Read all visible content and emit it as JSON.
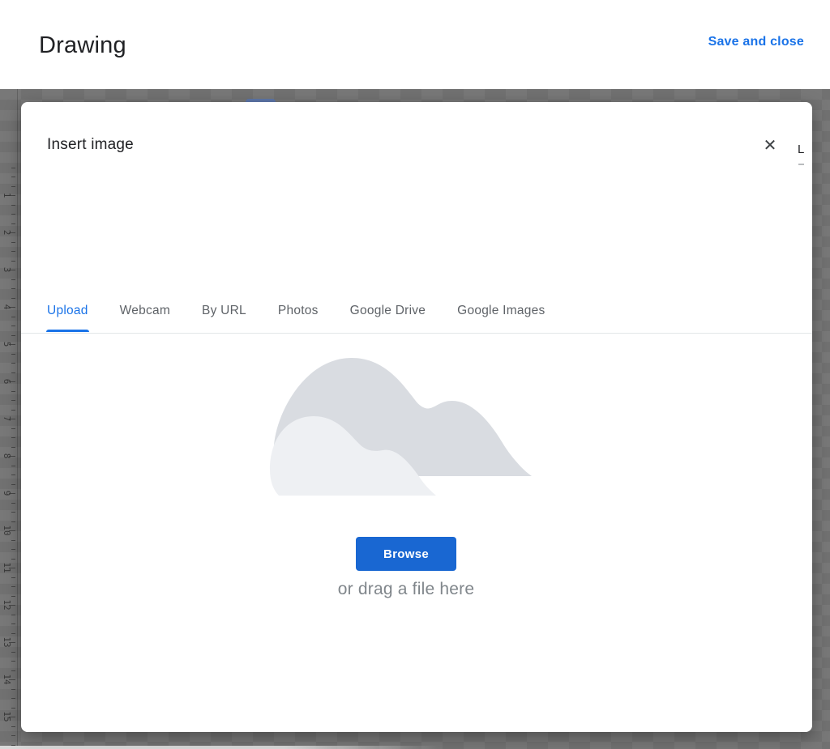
{
  "header": {
    "title": "Drawing",
    "save_and_close": "Save and close"
  },
  "dialog": {
    "title": "Insert image",
    "close_icon": "✕",
    "tabs": [
      {
        "label": "Upload",
        "active": true
      },
      {
        "label": "Webcam",
        "active": false
      },
      {
        "label": "By URL",
        "active": false
      },
      {
        "label": "Photos",
        "active": false
      },
      {
        "label": "Google Drive",
        "active": false
      },
      {
        "label": "Google Images",
        "active": false
      }
    ],
    "upload_panel": {
      "browse_label": "Browse",
      "drag_hint": "or drag a file here",
      "illustration": "cloud-illustration"
    },
    "stray_glyph": "L"
  },
  "ruler": {
    "numbers": [
      1,
      2,
      3,
      4,
      5,
      6,
      7,
      8,
      9,
      10,
      11,
      12,
      13,
      14,
      15
    ]
  },
  "colors": {
    "link_blue": "#1a73e8",
    "button_blue": "#1967d2",
    "backdrop_gray": "#757575",
    "cloud_back": "#d9dce1",
    "cloud_front": "#eef0f3"
  }
}
